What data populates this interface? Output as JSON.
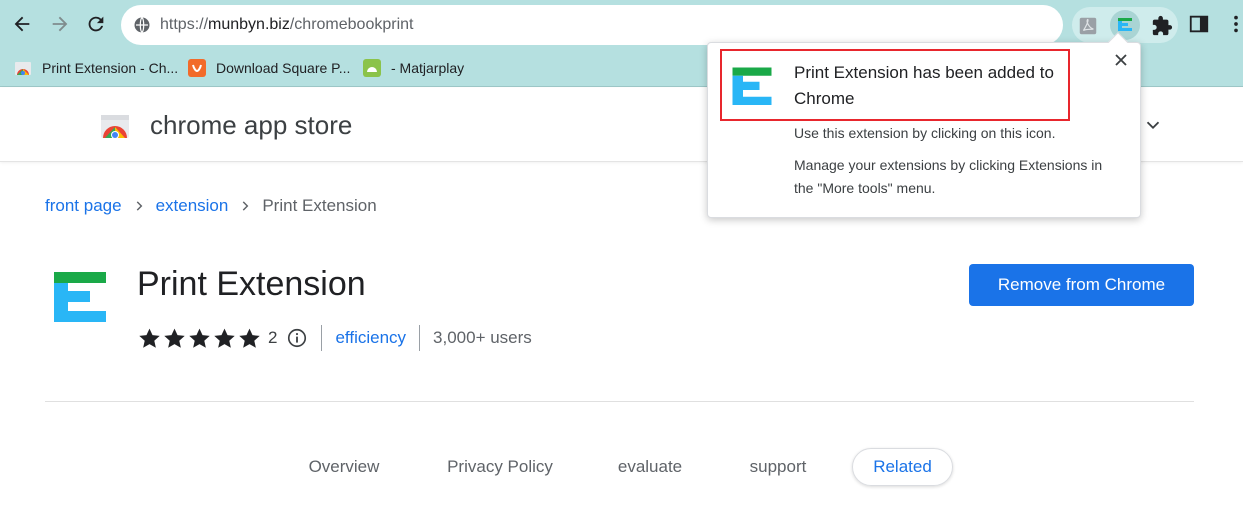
{
  "browser": {
    "url_scheme": "https://",
    "url_host": "munbyn.biz",
    "url_path": "/chromebookprint",
    "bookmarks": [
      {
        "label": "Print Extension - Ch...",
        "icon": "chrome-store-favicon"
      },
      {
        "label": "Download Square P...",
        "icon": "shield-favicon"
      },
      {
        "label": "- Matjarplay",
        "icon": "android-favicon"
      }
    ],
    "toolbar_icons": [
      "back-arrow-icon",
      "forward-arrow-icon",
      "reload-icon",
      "site-info-icon",
      "pdf-extension-icon",
      "print-extension-icon",
      "puzzle-icon",
      "side-panel-icon",
      "more-vert-icon"
    ]
  },
  "store": {
    "title": "chrome app store"
  },
  "breadcrumb": {
    "home": "front page",
    "category": "extension",
    "current": "Print Extension"
  },
  "item": {
    "name": "Print Extension",
    "rating": 5,
    "rating_count": "2",
    "category": "efficiency",
    "users": "3,000+ users",
    "action_label": "Remove from Chrome"
  },
  "tabs": [
    {
      "label": "Overview",
      "selected": false
    },
    {
      "label": "Privacy Policy",
      "selected": false
    },
    {
      "label": "evaluate",
      "selected": false
    },
    {
      "label": "support",
      "selected": false
    },
    {
      "label": "Related",
      "selected": true
    }
  ],
  "popup": {
    "title": "Print Extension has been added to Chrome",
    "line1": "Use this extension by clicking on this icon.",
    "line2": "Manage your extensions by clicking Extensions in the \"More tools\" menu."
  },
  "colors": {
    "toolbar_bg": "#b5e0e0",
    "accent": "#1a73e8",
    "highlight": "#e8262d",
    "logo_green": "#1aa948",
    "logo_blue": "#29b6f6"
  }
}
